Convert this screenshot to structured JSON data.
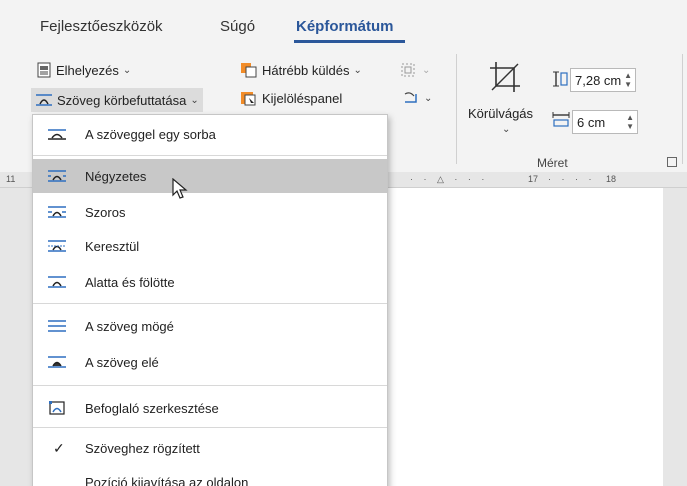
{
  "tabs": [
    {
      "label": "Fejlesztőeszközök"
    },
    {
      "label": "Súgó"
    },
    {
      "label": "Képformátum"
    }
  ],
  "ribbon": {
    "elhelyezes": "Elhelyezés",
    "szoveg_korbe": "Szöveg körbefuttatása",
    "hatrebb": "Hátrébb küldés",
    "kijelolespanel": "Kijelöléspanel",
    "korulvagas": "Körülvágás",
    "height_value": "7,28 cm",
    "width_value": "6 cm",
    "meret_label": "Méret"
  },
  "ruler": {
    "left_num": "11",
    "right_text": "17",
    "right_text2": "18"
  },
  "menu": {
    "items": [
      {
        "label": "A szöveggel egy sorba"
      },
      {
        "label": "Négyzetes"
      },
      {
        "label": "Szoros"
      },
      {
        "label": "Keresztül"
      },
      {
        "label": "Alatta és fölötte"
      },
      {
        "label": "A szöveg mögé"
      },
      {
        "label": "A szöveg elé"
      },
      {
        "label": "Befoglaló szerkesztése"
      },
      {
        "label": "Szöveghez rögzített"
      },
      {
        "label": "Pozíció kijavítása az oldalon"
      }
    ]
  },
  "colors": {
    "accent": "#2b579a",
    "highlight": "#c8c8c8",
    "icon_blue": "#2e6fc0"
  }
}
